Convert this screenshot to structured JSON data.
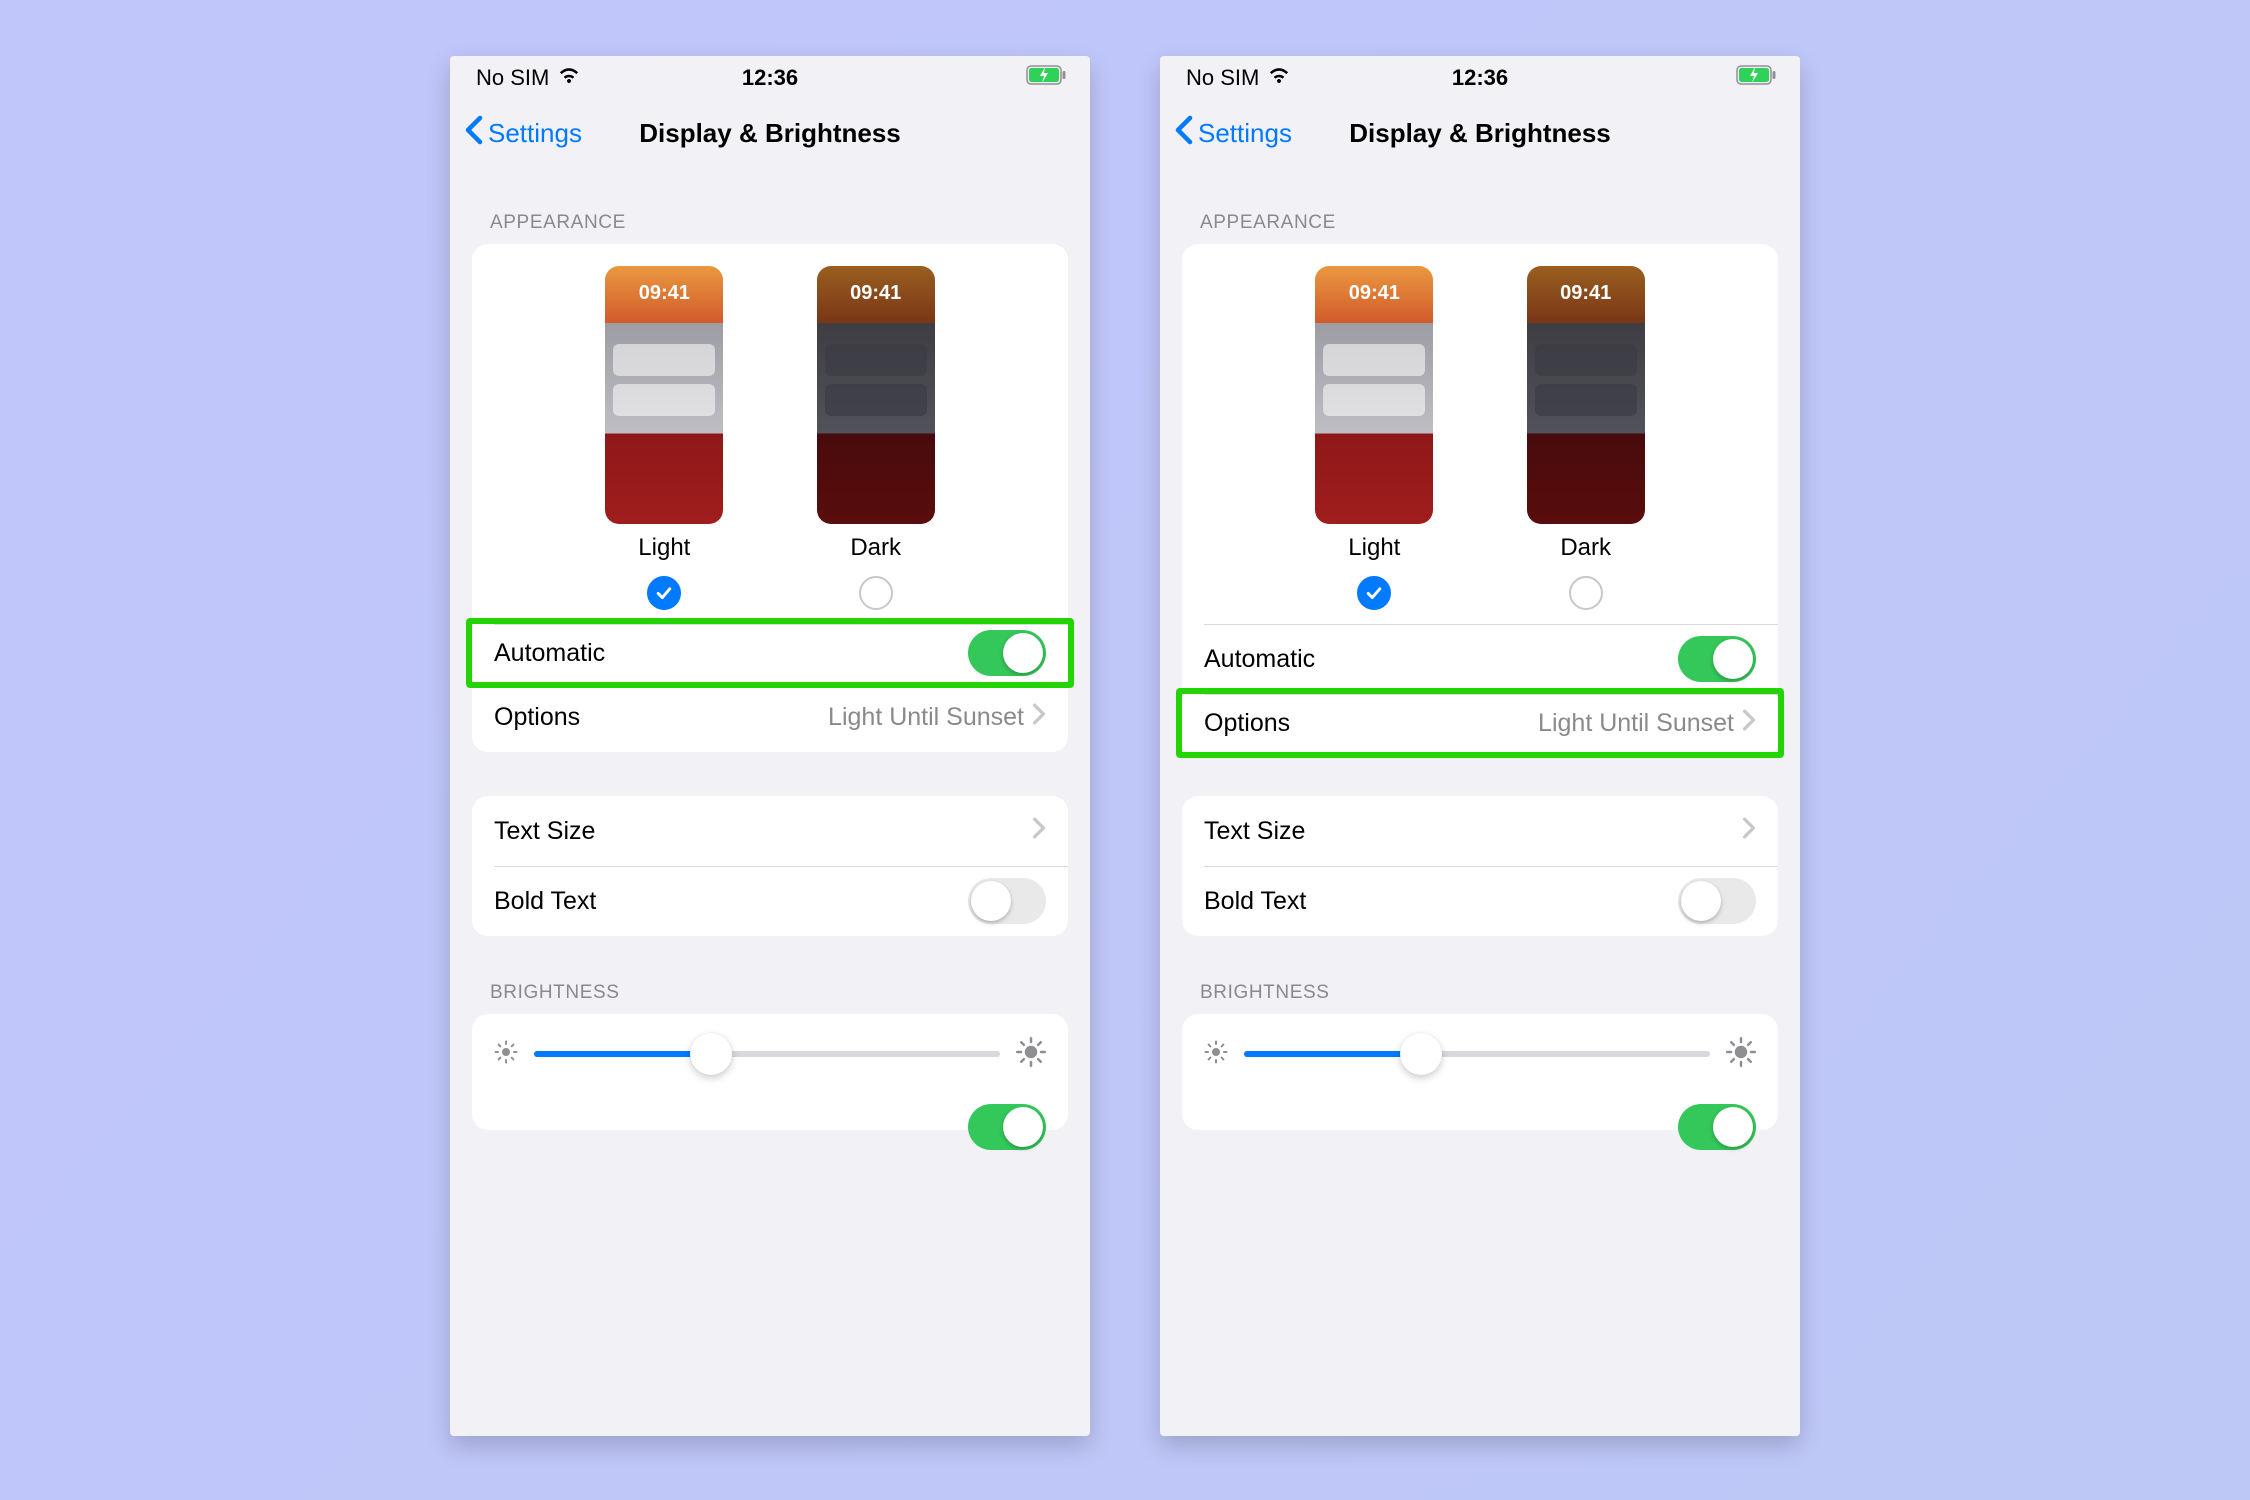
{
  "status": {
    "sim": "No SIM",
    "time": "12:36"
  },
  "nav": {
    "back": "Settings",
    "title": "Display & Brightness"
  },
  "sections": {
    "appearance_header": "APPEARANCE",
    "brightness_header": "BRIGHTNESS"
  },
  "appearance": {
    "preview_time": "09:41",
    "light_label": "Light",
    "dark_label": "Dark",
    "automatic_label": "Automatic",
    "options_label": "Options",
    "options_value": "Light Until Sunset"
  },
  "text": {
    "text_size_label": "Text Size",
    "bold_text_label": "Bold Text"
  },
  "screens": [
    {
      "highlight": "automatic"
    },
    {
      "highlight": "options"
    }
  ]
}
